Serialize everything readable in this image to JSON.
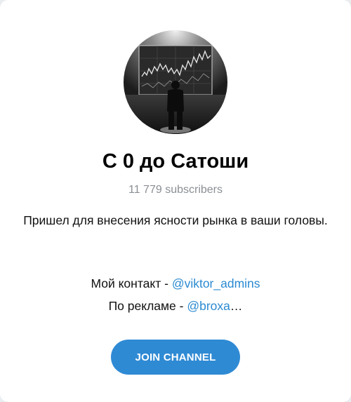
{
  "channel": {
    "title": "С 0 до Сатоши",
    "subscribers": "11 779 subscribers",
    "description": "Пришел для внесения ясности рынка в ваши головы.",
    "contact_prefix": "Мой контакт - ",
    "contact_handle": "@viktor_admins",
    "ads_prefix": "По рекламе - ",
    "ads_handle": "@broxa",
    "ads_ellipsis": "…"
  },
  "join_button": {
    "label": "JOIN CHANNEL"
  },
  "colors": {
    "accent": "#2f8ad4",
    "link": "#2b8ad1",
    "muted": "#8a8f94"
  },
  "avatar": {
    "icon": "trader-chart-avatar"
  }
}
